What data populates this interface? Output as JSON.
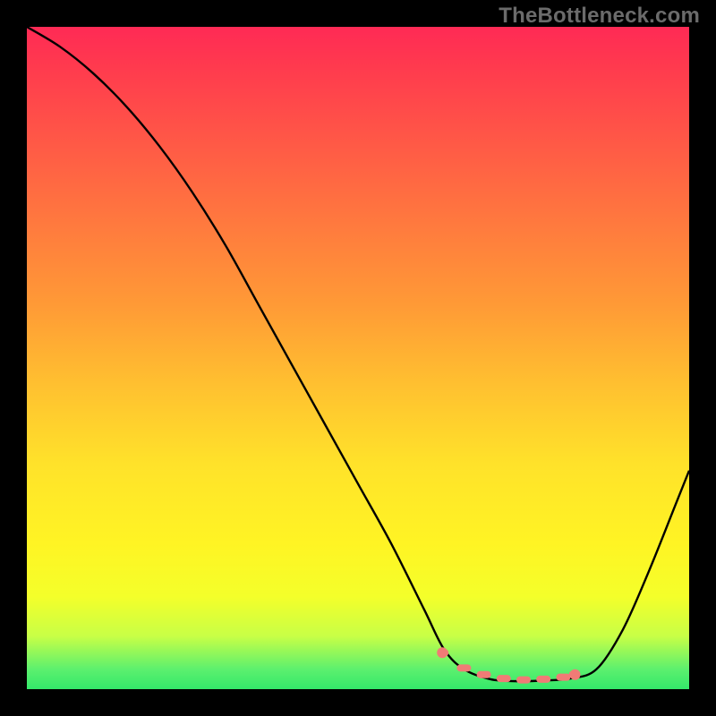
{
  "watermark": "TheBottleneck.com",
  "colors": {
    "frame": "#000000",
    "curve": "#000000",
    "marker": "#f07b76",
    "gradient_top": "#ff2a55",
    "gradient_mid": "#ffe22a",
    "gradient_bottom": "#34e86a"
  },
  "chart_data": {
    "type": "line",
    "title": "",
    "xlabel": "",
    "ylabel": "",
    "xlim": [
      0,
      100
    ],
    "ylim": [
      0,
      100
    ],
    "series": [
      {
        "name": "bottleneck-curve",
        "x": [
          0,
          5,
          10,
          15,
          20,
          25,
          30,
          35,
          40,
          45,
          50,
          55,
          60,
          63,
          66,
          70,
          74,
          78,
          82,
          86,
          90,
          94,
          98,
          100
        ],
        "values": [
          100,
          97,
          93,
          88,
          82,
          75,
          67,
          58,
          49,
          40,
          31,
          22,
          12,
          6,
          3,
          1.5,
          1.2,
          1.3,
          1.6,
          3,
          9,
          18,
          28,
          33
        ]
      }
    ],
    "markers": {
      "name": "highlight-band",
      "x": [
        63,
        66,
        69,
        72,
        75,
        78,
        81,
        82.5
      ],
      "values": [
        5.5,
        3.2,
        2.2,
        1.6,
        1.4,
        1.5,
        1.8,
        2.2
      ]
    }
  }
}
